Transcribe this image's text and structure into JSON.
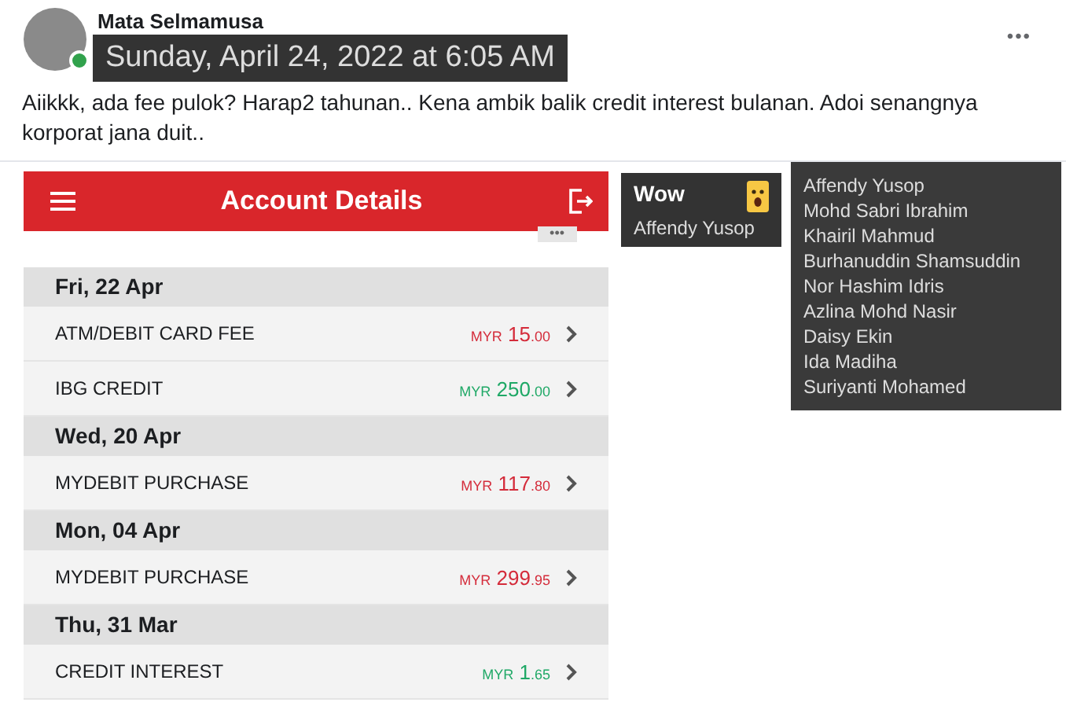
{
  "post": {
    "author": "Mata Selmamusa",
    "online": true,
    "timestamp_tooltip": "Sunday, April 24, 2022 at 6:05 AM",
    "more": "•••",
    "text": "Aiikkk, ada fee pulok? Harap2 tahunan.. Kena ambik balik credit interest bulanan. Adoi senangnya korporat  jana duit.."
  },
  "app_screenshot": {
    "title": "Account Details",
    "more_button": "•••",
    "groups": [
      {
        "date": "Fri, 22 Apr",
        "transactions": [
          {
            "description": "ATM/DEBIT CARD FEE",
            "kind": "debit",
            "currency": "MYR",
            "whole": "15",
            "decimals": ".00"
          },
          {
            "description": "IBG CREDIT",
            "kind": "credit",
            "currency": "MYR",
            "whole": "250",
            "decimals": ".00"
          }
        ]
      },
      {
        "date": "Wed, 20 Apr",
        "transactions": [
          {
            "description": "MYDEBIT PURCHASE",
            "kind": "debit",
            "currency": "MYR",
            "whole": "117",
            "decimals": ".80"
          }
        ]
      },
      {
        "date": "Mon, 04 Apr",
        "transactions": [
          {
            "description": "MYDEBIT PURCHASE",
            "kind": "debit",
            "currency": "MYR",
            "whole": "299",
            "decimals": ".95"
          }
        ]
      },
      {
        "date": "Thu, 31 Mar",
        "transactions": [
          {
            "description": "CREDIT INTEREST",
            "kind": "credit",
            "currency": "MYR",
            "whole": "1",
            "decimals": ".65"
          }
        ]
      }
    ]
  },
  "reaction_tooltip": {
    "reaction": "Wow",
    "person": "Affendy Yusop"
  },
  "reactors_tooltip": {
    "names": [
      "Affendy Yusop",
      "Mohd Sabri Ibrahim",
      "Khairil Mahmud",
      "Burhanuddin Shamsuddin",
      "Nor Hashim Idris",
      "Azlina Mohd Nasir",
      "Daisy Ekin",
      "Ida Madiha",
      "Suriyanti Mohamed"
    ]
  }
}
